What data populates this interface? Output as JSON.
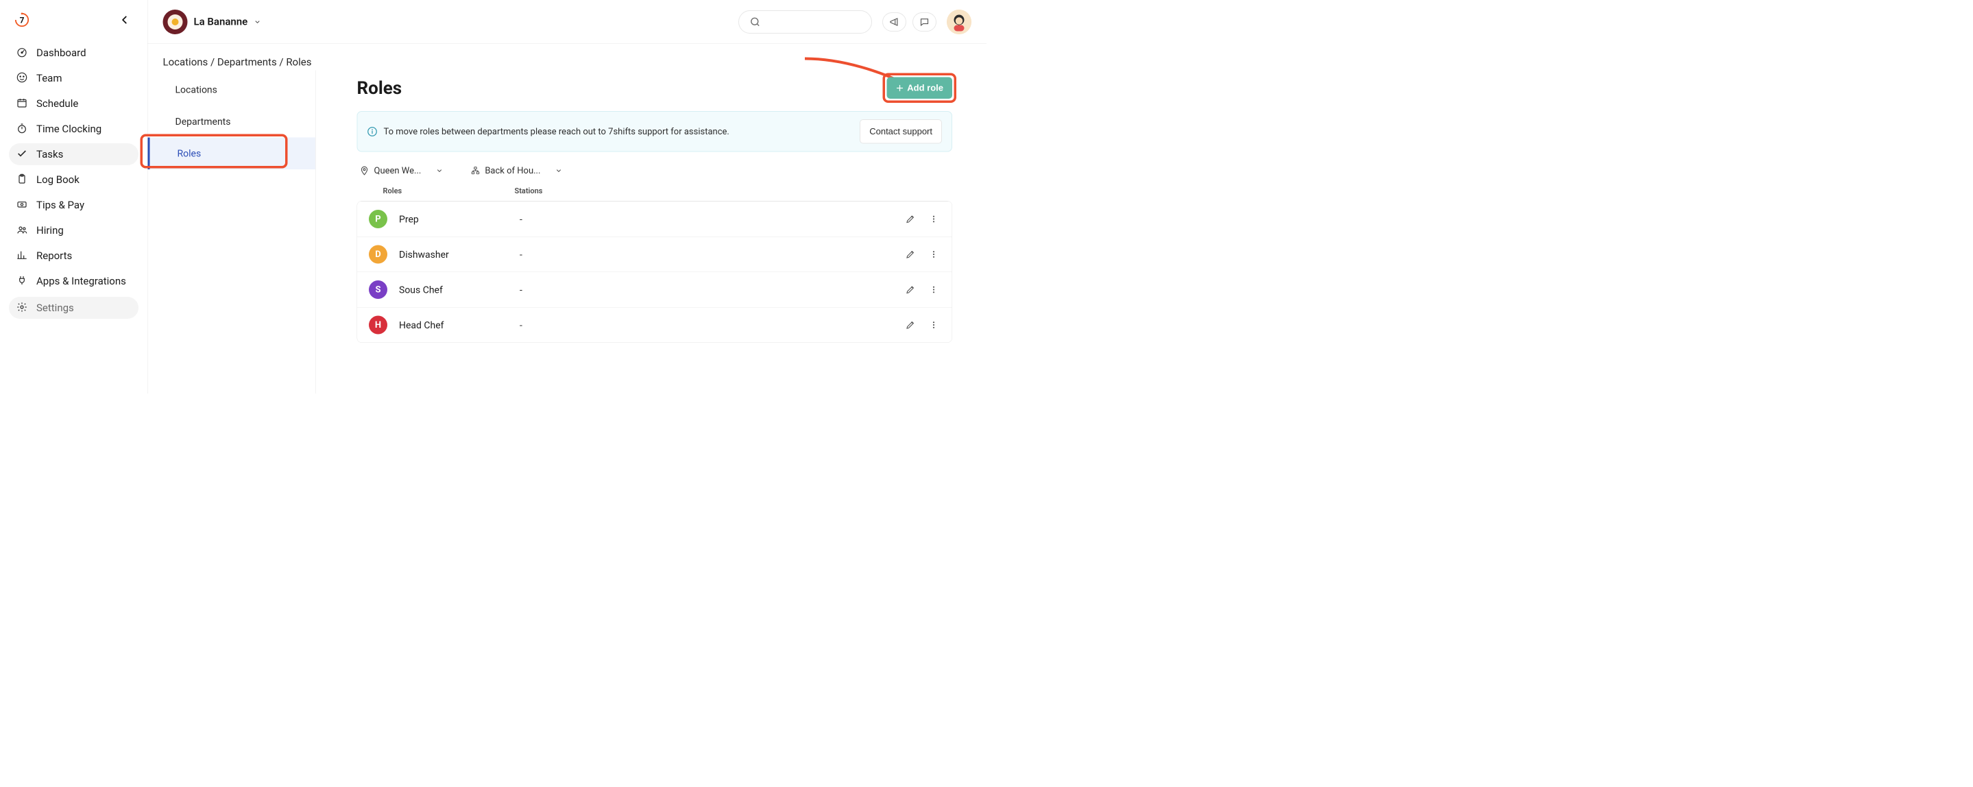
{
  "brand": {
    "product_name": "7shifts",
    "company_name": "La Bananne"
  },
  "sidebar": {
    "items": [
      {
        "label": "Dashboard",
        "icon": "gauge-icon"
      },
      {
        "label": "Team",
        "icon": "smile-icon"
      },
      {
        "label": "Schedule",
        "icon": "calendar-icon"
      },
      {
        "label": "Time Clocking",
        "icon": "stopwatch-icon"
      },
      {
        "label": "Tasks",
        "icon": "check-icon",
        "active": true
      },
      {
        "label": "Log Book",
        "icon": "clipboard-icon"
      },
      {
        "label": "Tips & Pay",
        "icon": "money-icon"
      },
      {
        "label": "Hiring",
        "icon": "people-icon"
      },
      {
        "label": "Reports",
        "icon": "bar-chart-icon"
      },
      {
        "label": "Apps & Integrations",
        "icon": "plug-icon"
      },
      {
        "label": "Settings",
        "icon": "gear-icon",
        "muted": true
      }
    ]
  },
  "breadcrumb": "Locations / Departments / Roles",
  "sub_tabs": {
    "items": [
      {
        "label": "Locations"
      },
      {
        "label": "Departments"
      },
      {
        "label": "Roles",
        "active": true
      }
    ]
  },
  "page": {
    "title": "Roles",
    "add_role_label": "Add role",
    "info_banner": {
      "text": "To move roles between departments please reach out to 7shifts support for assistance.",
      "cta": "Contact support"
    },
    "filters": {
      "location_label": "Queen We...",
      "department_label": "Back of Hou..."
    },
    "table": {
      "columns": [
        "Roles",
        "Stations"
      ],
      "rows": [
        {
          "letter": "P",
          "name": "Prep",
          "station": "-",
          "color": "#79c24a"
        },
        {
          "letter": "D",
          "name": "Dishwasher",
          "station": "-",
          "color": "#f2a637"
        },
        {
          "letter": "S",
          "name": "Sous Chef",
          "station": "-",
          "color": "#7a3fc5"
        },
        {
          "letter": "H",
          "name": "Head Chef",
          "station": "-",
          "color": "#d82f3b"
        }
      ]
    }
  },
  "colors": {
    "accent": "#5fb8a3",
    "annotation": "#ed4f2f"
  }
}
